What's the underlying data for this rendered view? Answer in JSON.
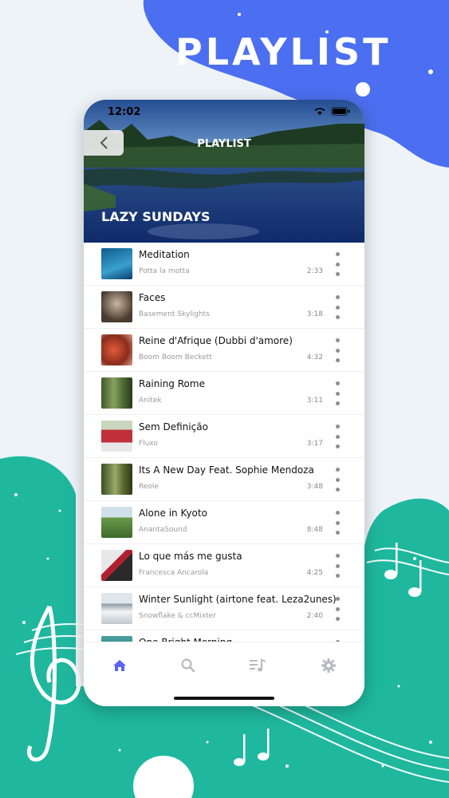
{
  "promo": {
    "title": "PLAYLIST"
  },
  "status": {
    "time": "12:02"
  },
  "header": {
    "title": "PLAYLIST",
    "playlist_name": "LAZY SUNDAYS"
  },
  "songs": [
    {
      "title": "Meditation",
      "artist": "Potta la motta",
      "duration": "2:33"
    },
    {
      "title": "Faces",
      "artist": "Basement Skylights",
      "duration": "3:18"
    },
    {
      "title": "Reine d'Afrique (Dubbi d'amore)",
      "artist": "Boom Boom Beckett",
      "duration": "4:32"
    },
    {
      "title": "Raining Rome",
      "artist": "Anitek",
      "duration": "3:11"
    },
    {
      "title": "Sem Definição",
      "artist": "Fluxo",
      "duration": "3:17"
    },
    {
      "title": "Its A New Day Feat. Sophie Mendoza",
      "artist": "Reole",
      "duration": "3:48"
    },
    {
      "title": "Alone in Kyoto",
      "artist": "AnantaSound",
      "duration": "8:48"
    },
    {
      "title": "Lo que más me gusta",
      "artist": "Francesca Ancarola",
      "duration": "4:25"
    },
    {
      "title": "Winter Sunlight (airtone feat. Leza2unes)",
      "artist": "Snowflake & ccMixter",
      "duration": "2:40"
    },
    {
      "title": "One Bright Morning",
      "artist": "",
      "duration": ""
    }
  ],
  "tabs": [
    {
      "name": "home",
      "icon": "home-icon",
      "active": true
    },
    {
      "name": "search",
      "icon": "search-icon",
      "active": false
    },
    {
      "name": "library",
      "icon": "music-list-icon",
      "active": false
    },
    {
      "name": "settings",
      "icon": "gear-icon",
      "active": false
    }
  ],
  "colors": {
    "accent": "#5b63f0",
    "promo_blue": "#4a6cf0",
    "teal": "#1fb8a0",
    "inactive": "#b9b9c3"
  }
}
